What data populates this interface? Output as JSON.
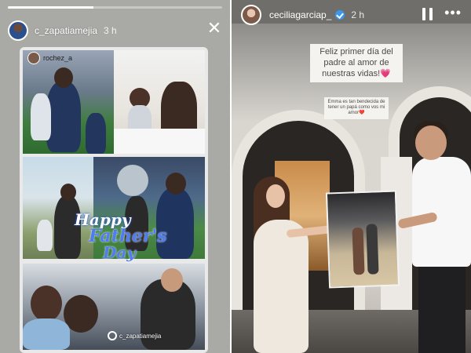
{
  "left_story": {
    "progress_fraction": 0.4,
    "username": "c_zapatiamejia",
    "time_ago": "3 h",
    "collage": {
      "tag_user": "rochez_a",
      "fathers_day": [
        "Happy",
        "Father's",
        "Day"
      ],
      "mention": "c_zapatiamejia"
    }
  },
  "right_story": {
    "username": "ceciliagarciap_",
    "time_ago": "2 h",
    "caption_main": "Feliz primer día del padre al amor de nuestras vidas!💗",
    "caption_small": "Emma es tan bendecida de tener un papá como vos mi amor❤️"
  },
  "icons": {
    "close": "close-icon",
    "pause": "pause-icon",
    "more": "more-icon",
    "verified": "verified-badge-icon"
  },
  "colors": {
    "verified": "#3897f0",
    "fathers_day_text": "#4f7cf0"
  }
}
